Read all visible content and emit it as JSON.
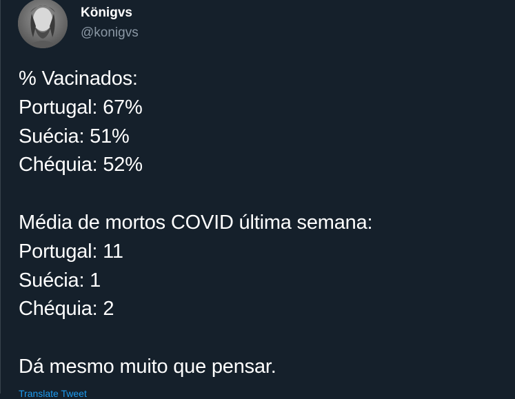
{
  "tweet": {
    "display_name": "Königvs",
    "handle": "@konigvs",
    "avatar_icon": "user-avatar-photo",
    "lines": [
      "% Vacinados:",
      "Portugal: 67%",
      "Suécia: 51%",
      "Chéquia: 52%",
      "",
      "Média de mortos COVID última semana:",
      "Portugal: 11",
      "Suécia: 1",
      "Chéquia: 2",
      "",
      "Dá mesmo muito que pensar."
    ],
    "translate_label": "Translate Tweet"
  },
  "colors": {
    "background": "#15202b",
    "text": "#ffffff",
    "secondary_text": "#8b98a5",
    "link": "#1d9bf0"
  }
}
